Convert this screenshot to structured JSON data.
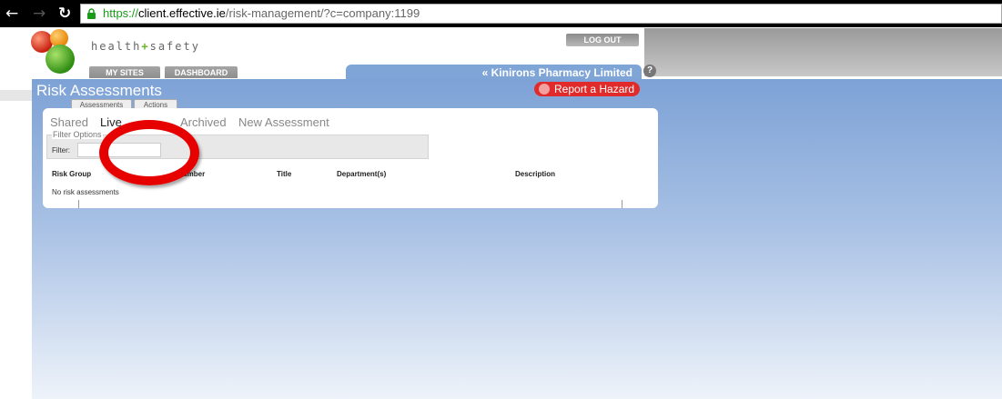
{
  "browser": {
    "url_scheme": "https://",
    "url_host": "client.effective.ie",
    "url_path": "/risk-management/?c=company:1199"
  },
  "header": {
    "brand_left": "health",
    "brand_plus": "+",
    "brand_right": "safety",
    "logout_label": "LOG OUT",
    "tabs": [
      {
        "label": "MY SITES"
      },
      {
        "label": "DASHBOARD"
      }
    ],
    "site_name": "« Kinirons Pharmacy Limited",
    "help_label": "?"
  },
  "page": {
    "title": "Risk Assessments",
    "hazard_label": "Report a Hazard",
    "sub_tabs": [
      {
        "label": "Assessments"
      },
      {
        "label": "Actions"
      }
    ],
    "view_tabs": [
      {
        "label": "Shared",
        "active": false
      },
      {
        "label": "Live",
        "active": true
      },
      {
        "label": "Archived",
        "active": false
      },
      {
        "label": "New Assessment",
        "active": false
      }
    ],
    "filter": {
      "legend": "Filter Options",
      "label": "Filter:",
      "value": ""
    },
    "table": {
      "columns": [
        "Risk Group",
        "Number",
        "Title",
        "Department(s)",
        "Description"
      ],
      "empty_message": "No risk assessments"
    }
  },
  "colors": {
    "accent_blue": "#7fa4d6",
    "hazard_red": "#e12a2a",
    "annotation_red": "#e60000",
    "brand_green": "#68b52a"
  },
  "icons": {
    "back": "left-arrow",
    "forward": "right-arrow",
    "reload": "reload",
    "lock": "padlock",
    "help": "question-circle",
    "hazard": "red-dot"
  }
}
